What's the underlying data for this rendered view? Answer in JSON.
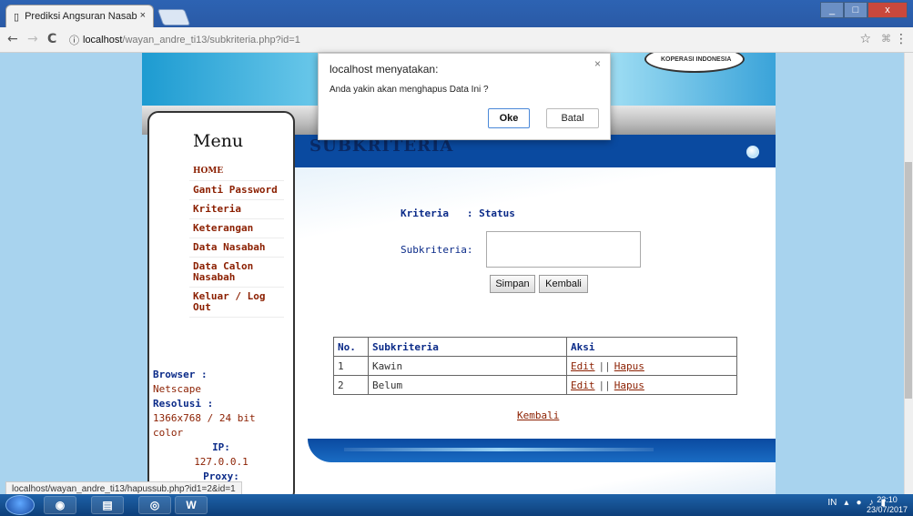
{
  "browser": {
    "tab_title": "Prediksi Angsuran Nasab",
    "tab_close": "×",
    "url_host": "localhost",
    "url_path": "/wayan_andre_ti13/subkriteria.php?id=1",
    "info_icon": "ⓘ",
    "back": "←",
    "forward": "→",
    "reload": "C",
    "star": "☆",
    "menu": "⋮",
    "win_min": "_",
    "win_max": "□",
    "win_close": "x"
  },
  "banner": {
    "logo_text": "KOPERASI INDONESIA"
  },
  "sidebar": {
    "title": "Menu",
    "items": [
      {
        "label": "HOME"
      },
      {
        "label": "Ganti Password"
      },
      {
        "label": "Kriteria"
      },
      {
        "label": "Keterangan"
      },
      {
        "label": "Data Nasabah"
      },
      {
        "label": "Data Calon Nasabah"
      },
      {
        "label": "Keluar / Log Out"
      }
    ],
    "info": {
      "browser_label": "Browser :",
      "browser_value": "Netscape",
      "resolution_label": "Resolusi :",
      "resolution_value": "1366x768 / 24 bit color",
      "ip_label": "IP:",
      "ip_value": "127.0.0.1",
      "proxy_label": "Proxy:"
    }
  },
  "page": {
    "title": "SUBKRITERIA",
    "kriteria_label": "Kriteria",
    "kriteria_value": ": Status",
    "subkriteria_label": "Subkriteria:",
    "subkriteria_value": "",
    "simpan": "Simpan",
    "kembali": "Kembali",
    "table": {
      "headers": [
        "No.",
        "Subkriteria",
        "Aksi"
      ],
      "rows": [
        {
          "no": "1",
          "name": "Kawin",
          "edit": "Edit",
          "sep": "||",
          "hapus": "Hapus"
        },
        {
          "no": "2",
          "name": "Belum",
          "edit": "Edit",
          "sep": "||",
          "hapus": "Hapus"
        }
      ]
    },
    "kembali_link": "Kembali"
  },
  "dialog": {
    "title": "localhost menyatakan:",
    "message": "Anda yakin akan menghapus Data Ini ?",
    "ok": "Oke",
    "cancel": "Batal",
    "close": "×"
  },
  "statusbar": {
    "url": "localhost/wayan_andre_ti13/hapussub.php?id1=2&id=1"
  },
  "taskbar": {
    "word_label": "W",
    "lang": "IN",
    "time": "23:10",
    "date": "23/07/2017"
  }
}
